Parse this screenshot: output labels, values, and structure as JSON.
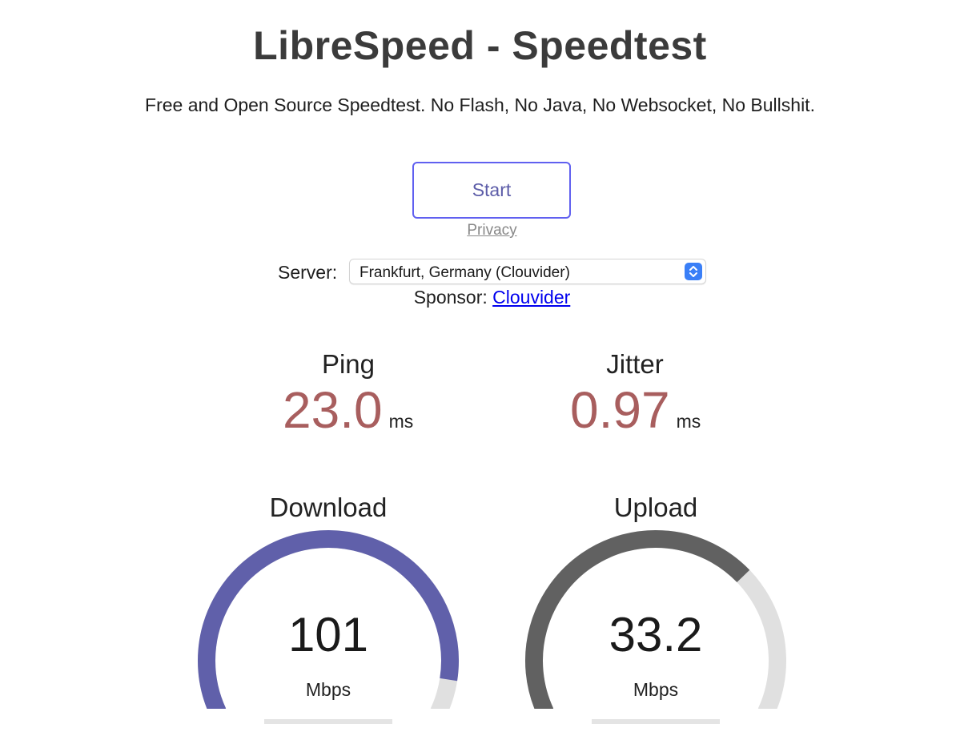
{
  "header": {
    "title": "LibreSpeed - Speedtest",
    "subtitle": "Free and Open Source Speedtest. No Flash, No Java, No Websocket, No Bullshit."
  },
  "controls": {
    "start_label": "Start",
    "privacy_label": "Privacy"
  },
  "server": {
    "label": "Server:",
    "selected": "Frankfurt, Germany (Clouvider)",
    "sponsor_label": "Sponsor:",
    "sponsor_name": "Clouvider"
  },
  "metrics": {
    "ping": {
      "label": "Ping",
      "value": "23.0",
      "unit": "ms"
    },
    "jitter": {
      "label": "Jitter",
      "value": "0.97",
      "unit": "ms"
    }
  },
  "gauges": {
    "download": {
      "label": "Download",
      "value": "101",
      "unit": "Mbps",
      "fill_fraction": 0.93,
      "color": "#6060aa"
    },
    "upload": {
      "label": "Upload",
      "value": "33.2",
      "unit": "Mbps",
      "fill_fraction": 0.7,
      "color": "#616161"
    }
  },
  "colors": {
    "accent_border": "#6060f0",
    "metric_value": "#a85e5e",
    "gauge_track": "#e0e0e0",
    "link": "#0000ee"
  }
}
